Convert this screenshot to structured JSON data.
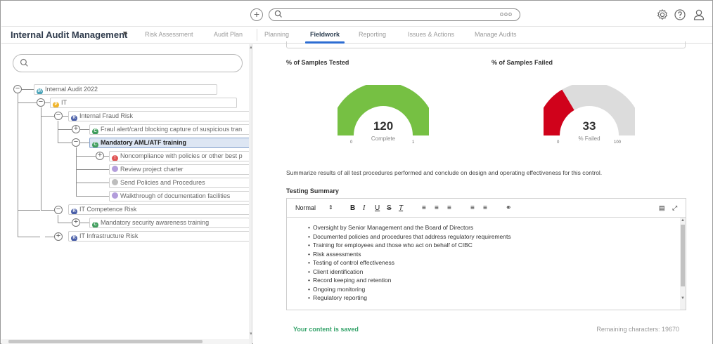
{
  "topbar": {
    "add_icon": "plus-circle-icon",
    "search_placeholder": "",
    "search_options": "ooo",
    "icons": [
      "gear-icon",
      "help-icon",
      "user-icon"
    ]
  },
  "nav": {
    "app_title": "Internal Audit Management",
    "items": [
      {
        "label": "Risk Assessment"
      },
      {
        "label": "Audit Plan"
      },
      {
        "label": "Planning"
      },
      {
        "label": "Fieldwork"
      },
      {
        "label": "Reporting"
      },
      {
        "label": "Issues & Actions"
      },
      {
        "label": "Manage Audits"
      }
    ],
    "active": "Fieldwork"
  },
  "tree": {
    "search_placeholder": "",
    "nodes": [
      {
        "label": "Internal Audit 2022",
        "badge": "IA",
        "color": "#4aa3b8"
      },
      {
        "label": "IT",
        "badge": "P",
        "color": "#f0b429"
      },
      {
        "label": "Internal Fraud Risk",
        "badge": "R",
        "color": "#4a5fa8"
      },
      {
        "label": "Fraul alert/card blocking capture of suspicious tran",
        "badge": "C",
        "color": "#3f9d5c"
      },
      {
        "label": "Mandatory AML/ATF training",
        "badge": "C",
        "color": "#3f9d5c"
      },
      {
        "label": "Noncompliance with policies or other best p",
        "badge": "!",
        "color": "#e05555"
      },
      {
        "label": "Review project charter",
        "badge": "",
        "color": "#b39ddb"
      },
      {
        "label": "Send Policies and Procedures",
        "badge": "",
        "color": "#bdbdbd"
      },
      {
        "label": "Walkthrough of documentation facilities",
        "badge": "",
        "color": "#b39ddb"
      },
      {
        "label": "IT Competence Risk",
        "badge": "R",
        "color": "#4a5fa8"
      },
      {
        "label": "Mandatory security awareness training",
        "badge": "C",
        "color": "#3f9d5c"
      },
      {
        "label": "IT Infrastructure Risk",
        "badge": "R",
        "color": "#4a5fa8"
      }
    ]
  },
  "gauges": {
    "tested": {
      "title": "% of Samples Tested",
      "value": "120",
      "sub": "Complete",
      "min": "0",
      "max": "1",
      "fraction": 1.0,
      "color": "#76c043"
    },
    "failed": {
      "title": "% of Samples Failed",
      "value": "33",
      "sub": "% Failed",
      "min": "0",
      "max": "100",
      "fraction": 0.33,
      "color": "#d0021b"
    }
  },
  "summary": {
    "prompt": "Summarize results of all test procedures performed and conclude on design and operating effectiveness for this control.",
    "label": "Testing Summary",
    "format": "Normal",
    "items": [
      "Oversight by Senior Management and the Board of Directors",
      "Documented policies and procedures that address regulatory requirements",
      "Training for employees and those who act on behalf of CIBC",
      "Risk assessments",
      "Testing of control effectiveness",
      "Client identification",
      "Record keeping and retention",
      "Ongoing monitoring",
      "Regulatory reporting"
    ],
    "saved_text": "Your content is saved",
    "remaining_text": "Remaining characters: 19670"
  }
}
